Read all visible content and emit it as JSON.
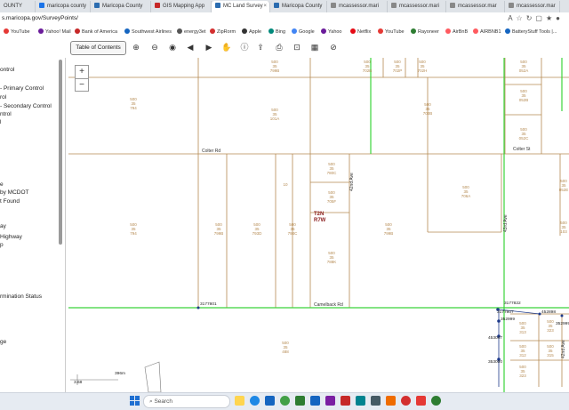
{
  "browser": {
    "tabs": [
      {
        "title": "OUNTY",
        "color": "#2b6cb0"
      },
      {
        "title": "maricopa county",
        "color": "#1a73e8"
      },
      {
        "title": "Maricopa County",
        "color": "#2b6cb0"
      },
      {
        "title": "GIS Mapping App",
        "color": "#c62828"
      },
      {
        "title": "MC Land Survey",
        "color": "#2b6cb0"
      },
      {
        "title": "Maricopa County",
        "color": "#2b6cb0"
      },
      {
        "title": "mcassessor.mari",
        "color": "#888888"
      },
      {
        "title": "mcassessor.mari",
        "color": "#888888"
      },
      {
        "title": "mcassessor.mar",
        "color": "#888888"
      },
      {
        "title": "mcassessor.mar",
        "color": "#888888"
      }
    ],
    "url": "s.maricopa.gov/SurveyPoints/",
    "favorites": [
      {
        "label": "YouTube",
        "color": "#e53935"
      },
      {
        "label": "Yahoo! Mail",
        "color": "#6a1b9a"
      },
      {
        "label": "Bank of America",
        "color": "#c62828"
      },
      {
        "label": "Southwest Airlines",
        "color": "#1565c0"
      },
      {
        "label": "energy3et",
        "color": "#555555"
      },
      {
        "label": "ZipRorm",
        "color": "#d32f2f"
      },
      {
        "label": "Apple",
        "color": "#333333"
      },
      {
        "label": "Bing",
        "color": "#00897b"
      },
      {
        "label": "Google",
        "color": "#4285f4"
      },
      {
        "label": "Yahoo",
        "color": "#6a1b9a"
      },
      {
        "label": "Netflix",
        "color": "#e50914"
      },
      {
        "label": "YouTube",
        "color": "#e53935"
      },
      {
        "label": "Rayoneer",
        "color": "#2e7d32"
      },
      {
        "label": "AirBnB",
        "color": "#ff5a5f"
      },
      {
        "label": "AIRBNB1",
        "color": "#ff5a5f"
      },
      {
        "label": "BatteryStuff Tools |...",
        "color": "#1565c0"
      }
    ]
  },
  "toolbar": {
    "toc_label": "Table of Contents"
  },
  "sidebar": {
    "items": [
      "ontrol",
      "- Primary Control",
      "rol",
      "- Secondary Control",
      "ntrol",
      "l",
      "e",
      "by MCDOT",
      "t Found",
      "ay",
      "Highway",
      "p",
      "rmination Status",
      "ge"
    ]
  },
  "map": {
    "road_labels": {
      "camelback": "Camelback Rd",
      "colter_left": "Colter Rd",
      "colter_right": "Colter St",
      "ave_north": "42nd Ave",
      "ave_mid": "43rd Ave",
      "ave_right": "42nd Ave"
    },
    "township": {
      "t": "T2N",
      "r": "R7W"
    },
    "point_labels": {
      "left": "3177801",
      "right": "3177822",
      "right2": "3177807",
      "p1": "352999",
      "p2": "452898",
      "p3": "352999",
      "p4": "453047",
      "p5": "353000",
      "scale": "396m",
      "scale2": "3.68"
    },
    "parcels": [
      {
        "id": "p1",
        "l1": "500",
        "l2": "35",
        "l3": "799B"
      },
      {
        "id": "p2",
        "l1": "500",
        "l2": "35",
        "l3": "702B"
      },
      {
        "id": "p3",
        "l1": "500",
        "l2": "35",
        "l3": "702P"
      },
      {
        "id": "p4",
        "l1": "500",
        "l2": "35",
        "l3": "702H"
      },
      {
        "id": "p5",
        "l1": "500",
        "l2": "35",
        "l3": "052A"
      },
      {
        "id": "p6",
        "l1": "500",
        "l2": "35",
        "l3": "052B"
      },
      {
        "id": "p7",
        "l1": "500",
        "l2": "35",
        "l3": "052C"
      },
      {
        "id": "p8",
        "l1": "500",
        "l2": "35",
        "l3": "052E"
      },
      {
        "id": "p9",
        "l1": "500",
        "l2": "35",
        "l3": "794"
      },
      {
        "id": "p10",
        "l1": "500",
        "l2": "35",
        "l3": "101A"
      },
      {
        "id": "p11",
        "l1": "500",
        "l2": "35",
        "l3": "703B"
      },
      {
        "id": "p12",
        "l1": "500",
        "l2": "35",
        "l3": "780C"
      },
      {
        "id": "p13",
        "l1": "500",
        "l2": "35",
        "l3": "705F"
      },
      {
        "id": "p14",
        "l1": "500",
        "l2": "35",
        "l3": "706A"
      },
      {
        "id": "p15",
        "l1": "500",
        "l2": "35",
        "l3": "794"
      },
      {
        "id": "p16",
        "l1": "500",
        "l2": "35",
        "l3": "799B"
      },
      {
        "id": "p17",
        "l1": "500",
        "l2": "35",
        "l3": "793D"
      },
      {
        "id": "p18",
        "l1": "500",
        "l2": "35",
        "l3": "793C"
      },
      {
        "id": "p19",
        "l1": "500",
        "l2": "35",
        "l3": "788K"
      },
      {
        "id": "p20",
        "l1": "500",
        "l2": "35",
        "l3": "799B"
      },
      {
        "id": "p21",
        "l1": "500",
        "l2": "35",
        "l3": "103"
      },
      {
        "id": "p22",
        "l1": "500",
        "l2": "35",
        "l3": "488"
      },
      {
        "id": "p23",
        "l1": "500",
        "l2": "35",
        "l3": "323"
      },
      {
        "id": "p24",
        "l1": "500",
        "l2": "35",
        "l3": "313"
      },
      {
        "id": "p25",
        "l1": "500",
        "l2": "35",
        "l3": "312"
      },
      {
        "id": "p26",
        "l1": "500",
        "l2": "35",
        "l3": "323"
      },
      {
        "id": "p27",
        "l1": "500",
        "l2": "35",
        "l3": "315"
      }
    ],
    "lot_ten": "10"
  },
  "taskbar": {
    "search_placeholder": "Search"
  }
}
